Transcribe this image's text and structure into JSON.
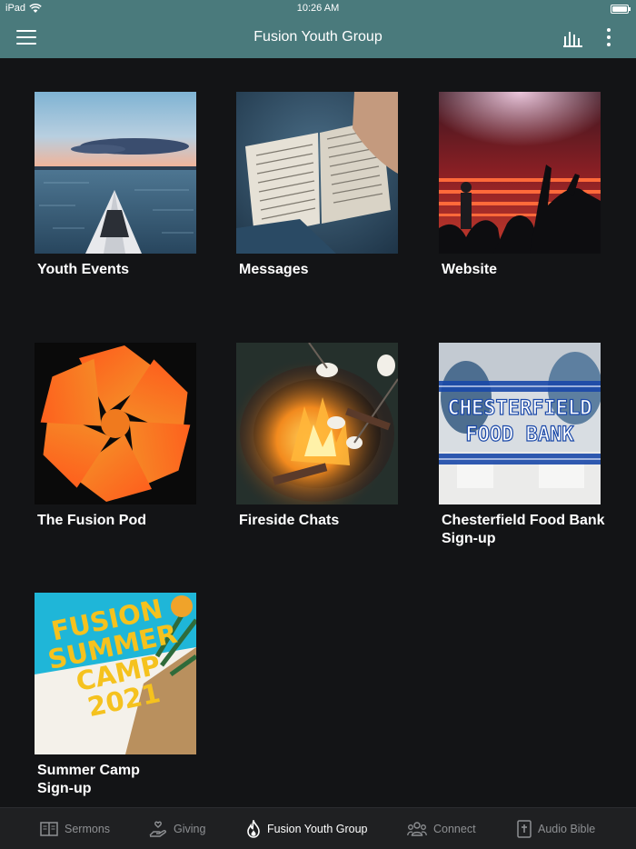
{
  "status_bar": {
    "device": "iPad",
    "time": "10:26 AM"
  },
  "header": {
    "title": "Fusion Youth Group"
  },
  "tiles": [
    {
      "label": "Youth Events"
    },
    {
      "label": "Messages"
    },
    {
      "label": "Website"
    },
    {
      "label": "The Fusion Pod"
    },
    {
      "label": "Fireside Chats"
    },
    {
      "label": "Chesterfield Food Bank Sign-up",
      "image_text_line1": "CHESTERFIELD",
      "image_text_line2": "FOOD BANK"
    },
    {
      "label": "Summer Camp Sign-up",
      "image_text": "FUSION SUMMER CAMP 2021"
    }
  ],
  "tab_bar": {
    "items": [
      {
        "label": "Sermons",
        "icon": "book-icon",
        "active": false
      },
      {
        "label": "Giving",
        "icon": "giving-hand-icon",
        "active": false
      },
      {
        "label": "Fusion Youth Group",
        "icon": "flame-icon",
        "active": true
      },
      {
        "label": "Connect",
        "icon": "people-icon",
        "active": false
      },
      {
        "label": "Audio Bible",
        "icon": "bible-icon",
        "active": false
      }
    ]
  },
  "colors": {
    "header": "#4a7a7c",
    "background": "#131416",
    "tab_bar": "#1f2022",
    "tab_inactive": "#8e9093"
  }
}
